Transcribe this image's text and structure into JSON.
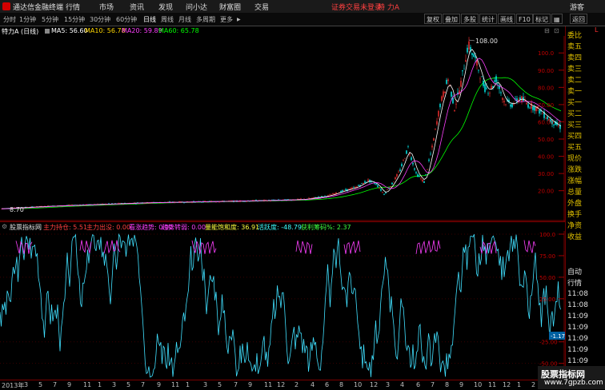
{
  "titlebar": {
    "app_name": "通达信金融终端",
    "menus": [
      "行情",
      "市场",
      "资讯",
      "发现",
      "问小达",
      "财富圈",
      "交易"
    ],
    "status": "证券交易未登录",
    "stock": "特 力A",
    "guest": "游客"
  },
  "toolbar": {
    "periods": [
      "分时",
      "1分钟",
      "5分钟",
      "15分钟",
      "30分钟",
      "60分钟",
      "日线",
      "周线",
      "月线",
      "多周期",
      "更多"
    ],
    "active_period": "日线",
    "right_buttons": [
      "复权",
      "叠加",
      "多股",
      "统计",
      "画线",
      "F10",
      "标记",
      "返回"
    ],
    "arrow": "▶"
  },
  "main_chart": {
    "title": "特力A (日线)",
    "ma": [
      {
        "label": "MA5: 56.60",
        "color": "#ffffff"
      },
      {
        "label": "MA10: 56.78",
        "color": "#ffd700"
      },
      {
        "label": "MA20: 59.89",
        "color": "#ff40ff"
      },
      {
        "label": "MA60: 65.78",
        "color": "#00ff00"
      }
    ],
    "high_label": "108.00",
    "low_label": "8.70",
    "marker": "定",
    "y_ticks": [
      "100.0",
      "90.00",
      "80.00",
      "70.00",
      "60.00",
      "50.00",
      "40.00",
      "30.00",
      "20.00"
    ]
  },
  "indicator": {
    "name": "股票指标网",
    "items": [
      {
        "label": "主力持仓: 5.51",
        "color": "#ff4040"
      },
      {
        "label": "主力出没: 0.00",
        "color": "#ff4040"
      },
      {
        "label": "看涨趋势: 0.00",
        "color": "#ff40ff"
      },
      {
        "label": "趋势转弱: 0.00",
        "color": "#ff40ff"
      },
      {
        "label": "量能饱和度: 36.91",
        "color": "#ffff40"
      },
      {
        "label": "活跃度: -48.79",
        "color": "#40ffff"
      },
      {
        "label": "获利筹码%: 2.37",
        "color": "#40ff40"
      }
    ],
    "y_ticks": [
      "100.0",
      "75.00",
      "50.00",
      "25.00",
      "-25.00",
      "-50.00"
    ],
    "current_value": "-1.17"
  },
  "x_axis": [
    "2013年",
    "3",
    "5",
    "7",
    "9",
    "11",
    "1",
    "3",
    "5",
    "7",
    "9",
    "11",
    "1",
    "3",
    "5",
    "7",
    "9",
    "11",
    "12",
    "2",
    "4",
    "6",
    "8",
    "10",
    "12",
    "3",
    "4",
    "6",
    "7",
    "8",
    "9",
    "10",
    "11",
    "12",
    "1",
    "2"
  ],
  "right_panel": {
    "header": "L",
    "labels": [
      "委比",
      "卖五",
      "卖四",
      "卖三",
      "卖二",
      "卖一",
      "买一",
      "买二",
      "买三",
      "买四",
      "买五",
      "现价",
      "涨跌",
      "涨幅",
      "总量",
      "外盘",
      "换手",
      "净资",
      "收益"
    ],
    "auto_label": "自动",
    "quotes_label": "行情",
    "times": [
      "11:08",
      "11:08",
      "11:09",
      "11:09",
      "11:09",
      "11:09",
      "11:09",
      "11:09",
      "11:09"
    ]
  },
  "watermark": {
    "title": "股票指标网",
    "url": "www.7gpzb.com"
  }
}
